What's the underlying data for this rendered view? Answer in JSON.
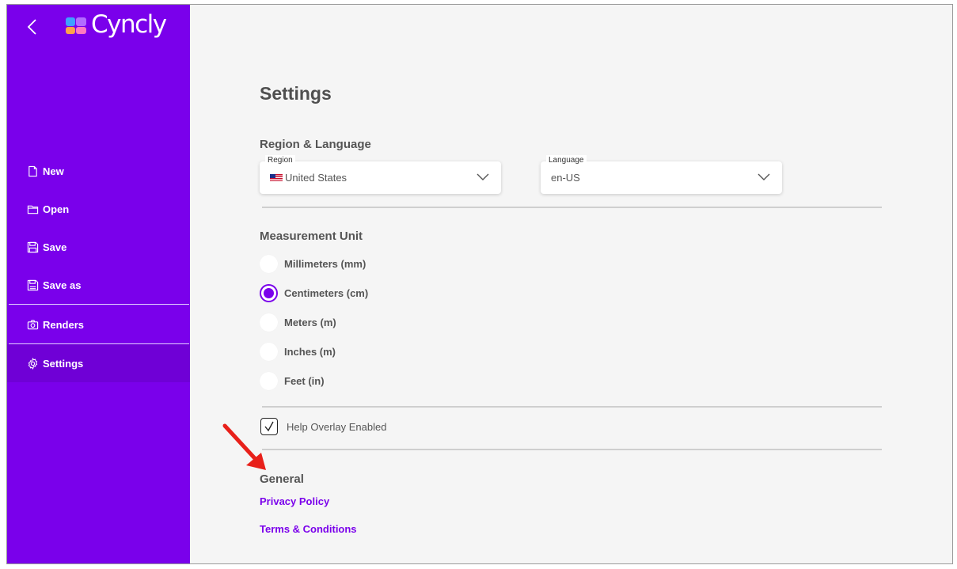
{
  "app": {
    "name": "Cyncly",
    "colors": {
      "brand": "#7a00eb",
      "accent_link": "#7a00eb",
      "annotation": "#e8201a"
    }
  },
  "sidebar": {
    "items": [
      {
        "label": "New",
        "icon": "file-icon"
      },
      {
        "label": "Open",
        "icon": "folder-icon"
      },
      {
        "label": "Save",
        "icon": "save-icon"
      },
      {
        "label": "Save as",
        "icon": "save-as-icon"
      },
      {
        "label": "Renders",
        "icon": "camera-icon"
      },
      {
        "label": "Settings",
        "icon": "gear-icon",
        "active": true
      }
    ]
  },
  "settings": {
    "title": "Settings",
    "region_language": {
      "title": "Region & Language",
      "region": {
        "label": "Region",
        "value": "United States"
      },
      "language": {
        "label": "Language",
        "value": "en-US"
      }
    },
    "measurement": {
      "title": "Measurement Unit",
      "options": [
        {
          "label": "Millimeters (mm)",
          "checked": false
        },
        {
          "label": "Centimeters (cm)",
          "checked": true
        },
        {
          "label": "Meters (m)",
          "checked": false
        },
        {
          "label": "Inches (m)",
          "checked": false
        },
        {
          "label": "Feet (in)",
          "checked": false
        }
      ]
    },
    "help_overlay": {
      "label": "Help Overlay Enabled",
      "checked": true
    },
    "general": {
      "title": "General",
      "links": [
        "Privacy Policy",
        "Terms & Conditions"
      ]
    }
  }
}
